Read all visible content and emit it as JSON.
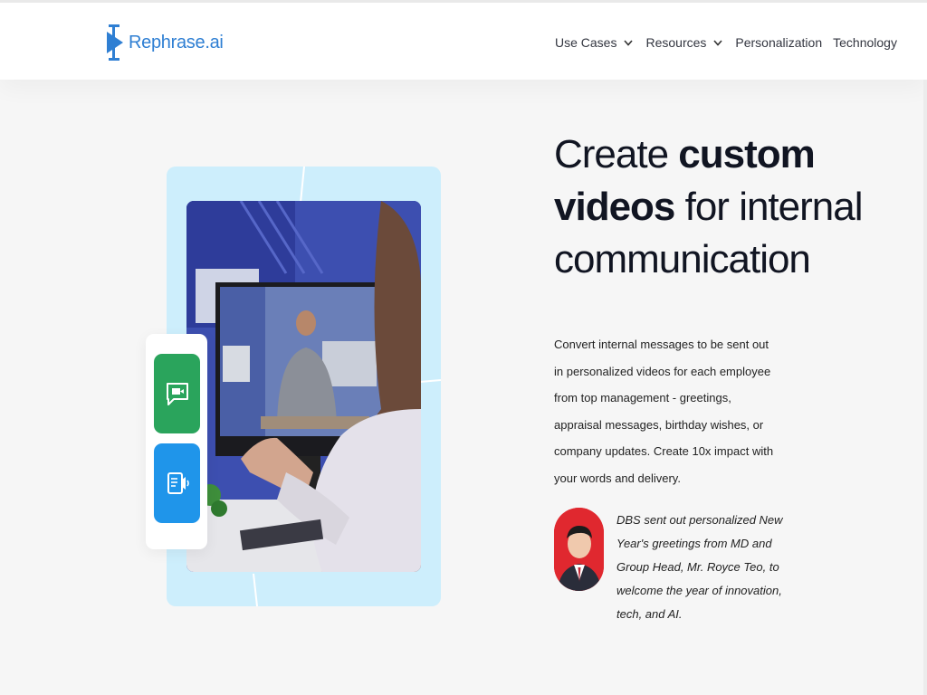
{
  "brand": {
    "name": "Rephrase.ai",
    "color": "#2f7fd3"
  },
  "nav": {
    "items": [
      {
        "label": "Use Cases",
        "has_dropdown": true
      },
      {
        "label": "Resources",
        "has_dropdown": true
      },
      {
        "label": "Personalization",
        "has_dropdown": false
      },
      {
        "label": "Technology",
        "has_dropdown": false
      }
    ]
  },
  "hero": {
    "headline_part1": "Create ",
    "headline_bold1": "custom videos",
    "headline_part2": " for internal communication",
    "description": "Convert internal messages to be sent out in personalized videos for each employee from top management - greetings, appraisal messages, birthday wishes, or company updates. Create 10x impact with your words and delivery.",
    "features": [
      {
        "icon": "video-chat-icon",
        "color": "#2aa45c"
      },
      {
        "icon": "audio-document-icon",
        "color": "#1f95ea"
      }
    ]
  },
  "testimonial": {
    "quote": "DBS sent out personalized New Year's greetings from MD and Group Head, Mr. Royce Teo, to welcome the year of innovation, tech, and AI.",
    "avatar_bg": "#e0282f"
  }
}
